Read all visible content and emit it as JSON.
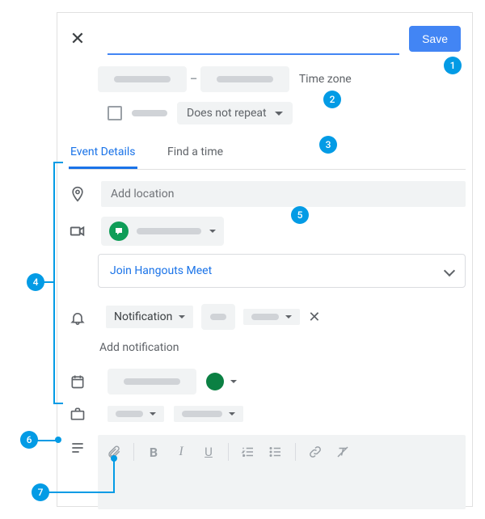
{
  "header": {
    "save_label": "Save"
  },
  "datetime": {
    "timezone_label": "Time zone",
    "repeat_label": "Does not repeat"
  },
  "tabs": {
    "details": "Event Details",
    "find_time": "Find a time"
  },
  "details": {
    "location_placeholder": "Add location",
    "join_meet": "Join Hangouts Meet",
    "notification_label": "Notification",
    "add_notification": "Add notification"
  },
  "badges": {
    "b1": "1",
    "b2": "2",
    "b3": "3",
    "b4": "4",
    "b5": "5",
    "b6": "6",
    "b7": "7"
  }
}
